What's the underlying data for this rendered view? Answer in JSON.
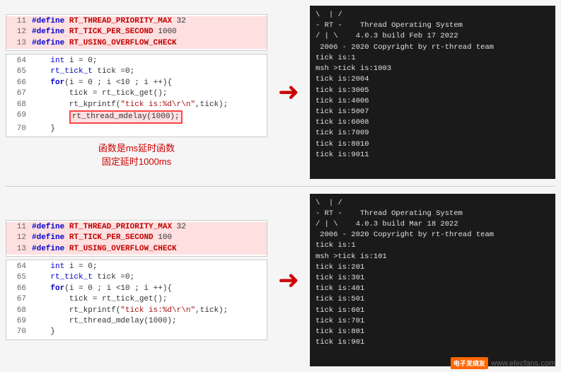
{
  "row1": {
    "codeTop": [
      {
        "num": "11",
        "text": "#define RT_THREAD_PRIORITY_MAX 32",
        "highlight": true
      },
      {
        "num": "12",
        "text": "#define RT_TICK_PER_SECOND 1000",
        "highlight": true
      },
      {
        "num": "13",
        "text": "#define RT_USING_OVERFLOW_CHECK",
        "highlight": true
      }
    ],
    "codeMain": [
      {
        "num": "64",
        "text": "    int i = 0;"
      },
      {
        "num": "65",
        "text": "    rt_tick_t tick =0;"
      },
      {
        "num": "66",
        "text": "    for(i = 0 ; i <10 ; i ++){"
      },
      {
        "num": "67",
        "text": "        tick = rt_tick_get();"
      },
      {
        "num": "68",
        "text": "        rt_kprintf(\"tick is:%d\\r\\n\",tick);"
      },
      {
        "num": "69",
        "text": "        rt_thread_mdelay(1000);",
        "boxHighlight": true
      },
      {
        "num": "70",
        "text": "    }"
      }
    ],
    "label1": "函数是ms延时函数",
    "label2": "固定延时1000ms",
    "terminal": [
      "\\ | /",
      "- RT -    Thread Operating System",
      "/ | \\    4.0.3 build Feb 17 2022",
      " 2006 - 2020 Copyright by rt-thread team",
      "tick is:1",
      "msh >tick is:1003",
      "tick is:2004",
      "tick is:3005",
      "tick is:4006",
      "tick is:5007",
      "tick is:6008",
      "tick is:7009",
      "tick is:8010",
      "tick is:9011"
    ]
  },
  "row2": {
    "codeTop": [
      {
        "num": "11",
        "text": "#define RT_THREAD_PRIORITY_MAX 32",
        "highlight": true
      },
      {
        "num": "12",
        "text": "#define RT_TICK_PER_SECOND 100",
        "highlight": true
      },
      {
        "num": "13",
        "text": "#define RT_USING_OVERFLOW_CHECK",
        "highlight": true
      }
    ],
    "codeMain": [
      {
        "num": "64",
        "text": "    int i = 0;"
      },
      {
        "num": "65",
        "text": "    rt_tick_t tick =0;"
      },
      {
        "num": "66",
        "text": "    for(i = 0 ; i <10 ; i ++){"
      },
      {
        "num": "67",
        "text": "        tick = rt_tick_get();"
      },
      {
        "num": "68",
        "text": "        rt_kprintf(\"tick is:%d\\r\\n\",tick);"
      },
      {
        "num": "69",
        "text": "        rt_thread_mdelay(1000);"
      },
      {
        "num": "70",
        "text": "    }"
      }
    ],
    "terminal": [
      "\\ | /",
      "- RT -    Thread Operating System",
      "/ | \\    4.0.3 build Mar 18 2022",
      " 2006 - 2020 Copyright by rt-thread team",
      "tick is:1",
      "msh >tick is:101",
      "tick is:201",
      "tick is:301",
      "tick is:401",
      "tick is:501",
      "tick is:601",
      "tick is:701",
      "tick is:801",
      "tick is:901"
    ]
  },
  "watermark": {
    "logo": "电子发烧友",
    "url": "www.elecfans.com"
  }
}
